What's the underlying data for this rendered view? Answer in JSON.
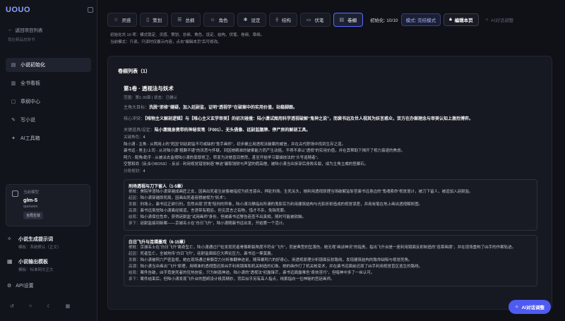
{
  "app": {
    "logo_main": "UOUO",
    "logo_accent": ""
  },
  "sidebar": {
    "back_label": "返回项目列表",
    "back_sub": "我在精品皮肤书",
    "nav": [
      {
        "label": "小说初始化",
        "icon": "book-icon",
        "active": true
      },
      {
        "label": "全书看板",
        "icon": "chart-icon",
        "active": false
      },
      {
        "label": "章纲中心",
        "icon": "file-icon",
        "active": false
      },
      {
        "label": "写小说",
        "icon": "pen-icon",
        "active": false
      },
      {
        "label": "AI工具箱",
        "icon": "toolbox-icon",
        "active": false
      }
    ],
    "model": {
      "label": "当前模型",
      "name": "glm-5",
      "provider": "qianwen",
      "badge": "全局生效"
    },
    "tools": [
      {
        "title": "小说生成提示词",
        "sub": "模板：系统默认（正文）",
        "icon": "sparkle-icon"
      },
      {
        "title": "小说输出模板",
        "sub": "模板：标准网文正文",
        "icon": "template-icon"
      }
    ],
    "api_label": "API设置"
  },
  "toolbar": {
    "tabs": [
      {
        "label": "灵感",
        "icon": "bulb-icon",
        "active": false
      },
      {
        "label": "策划",
        "icon": "book-open-icon",
        "active": false
      },
      {
        "label": "总纲",
        "icon": "list-icon",
        "active": false
      },
      {
        "label": "角色",
        "icon": "user-icon",
        "active": false
      },
      {
        "label": "设定",
        "icon": "settings-icon",
        "active": false
      },
      {
        "label": "结构",
        "icon": "structure-icon",
        "active": false
      },
      {
        "label": "伏笔",
        "icon": "note-icon",
        "active": false
      },
      {
        "label": "卷纲",
        "icon": "doc-icon",
        "active": true
      }
    ],
    "progress": "初始化: 10/10",
    "mode": "模式: 完结模式",
    "edit_label": "编辑本页",
    "ai_label": "AI对话调整"
  },
  "info": {
    "line1": "初始化共 10 项：模式锁定、灵感、策划、总纲、角色、设定、结构、伏笔、卷纲、章纲。",
    "line2": "当前模式：只读。只读时仅展示内容，点击“编辑本页”后可修改。"
  },
  "panel": {
    "title": "卷纲列表（1）",
    "volume": {
      "title": "第1卷 · 透视法与妖术",
      "meta": "范围：第1-30章 | 状态：已确认",
      "goal_k": "主角大目标：",
      "goal_v": "洗脱“邪修”嫌疑，加入廷尉监，证明“透视学”在破案中的实用价值，站稳脚跟。",
      "conflict_k": "核心冲突：",
      "conflict_v": "【唯物主义解剖逻辑】与【唯心主义玄学审美】的初次碰撞：陆小潇试图用科学透视破解“鬼神之说”，而裴书远及世人视其为妖言惑众，双方在办案理念与审美认知上激烈博弈。",
      "items_k": "关键道具/设定：",
      "items_v": "陆小潇随身携带的神秘炭笔（F001）、无头俑像、廷尉监腰牌、停尸房的解剖工具。",
      "roles_k": "关键角色：",
      "roles_count": "4",
      "roles": [
        "陆小潇 - 主角 - 从照用上的“死因”到廷尉监不可或缺的“鬼手画师”，初步确立用透视法破案的威信，并在古代职场中找到生存之道。",
        "裴书远 - 男主/上司 - 从对陆小潇“粗蹶不堪”的厌恶与怀疑，到因她精准的破案能力而产生动摇，不得不承认“透视”的实用价值，并在其帮助下揭开了视力衰退的焦虑。",
        "阿六 - 配角/助手 - 从被派去监视陆小潇的靠厚修卫，转变为对她盲目崇拜，甚至开始学习幕描技法的“头号追随者”。",
        "空慧和尚（反派小BOSS）- 反派 - 利用视觉错觉制造“神迹”骗取钱财与声望的假高僧，被陆小潇当众拆穿后身败名裂，成为主角立威的垫脚石。"
      ],
      "episodes_k": "分段规划：",
      "episodes_count": "4",
      "episodes": [
        {
          "title": "刑场透视与刀下留人（1-5章）",
          "lines": [
            {
              "k": "梗概：",
              "v": "美院学渣陆小潇穿越成画匠之女，因画出死者生前像被指控为妖言惑众，押赴刑场。生死关头，她利用透视原理当场破解监斩官裴书远身边的“鬼魂索命”视觉诡计，被刀下留人，被迫加入廷尉监。"
            },
            {
              "k": "起因：",
              "v": "陆小潇穿越即死局，因画出死者容貌被视为“妖术”。"
            },
            {
              "k": "发展：",
              "v": "刑场上，裴书远正欲行刑，忽然出现“厉鬼”阻刑的异象，陆小潇冷静指出所谓的鬼影实为利用建筑结构与光影折射造成的视觉误差，并用炭笔在地上画出透视解析图。"
            },
            {
              "k": "高潮：",
              "v": "裴书远虽觉陆小潇离经叛道，言语带有粗俗，但见其言之有物，惜才不杀，免除死罪。"
            },
            {
              "k": "结局：",
              "v": "陆小潇保住性命，获得廷尉监“试用画师”身份，但被裴书远警告若查不出真相，随时可能被砍脑。"
            },
            {
              "k": "承下：",
              "v": "廷尉监接到新案——京城名士在“白日飞升”，陆小潇随裴书远出发，开始第一个活计。"
            }
          ]
        },
        {
          "title": "白日飞升与连環墨戏（6-15章）",
          "lines": [
            {
              "k": "梗概：",
              "v": "京城名士在“白日飞升”离奇坠亡，陆小潇通过尸检发现死者骨骼断裂角度不符合“飞升”，而是典型的坠落伤。她无视“画谈神灵”的指责，指出飞升台是一座利用镜面反射制造的“连章画境”，并在现场重构了凶手的作案轨迹。"
            },
            {
              "k": "起因：",
              "v": "死者坠亡，全城热传“白日飞升”，廷尉监面临巨大舆论压力，裴书远一筹莫展。"
            },
            {
              "k": "发展：",
              "v": "陆小潇被阿六严密监视，她在现场通过骨骼受力分析推翻神迹说，随带暴阿六的好奇心，用透视原理分析镜面反射路线，发现建筑结构的致命缺陷与视觉死角。"
            },
            {
              "k": "高潮：",
              "v": "陆小潇当众画出“飞升”原理，用精准的透视图还原凶手利用镜面和机关制造的幻象。她的画作打了机关帐变术，并在裴书远面前还原了凶手利用视觉盲区逃生的路线。"
            },
            {
              "k": "结局：",
              "v": "案件告破，凶手竟是死者的狂热信徒，只为制造神迹。陆小潇的“透视法”初露锋芒，裴书远面露难色“奇技淫巧”，但暗神中多了一丝认可。"
            },
            {
              "k": "承下：",
              "v": "案件结束后，但陆小潇发现飞升台的图纸设计极其精妙，背后似乎另有高人指点，线索指向一位神秘的宫廷画师。"
            }
          ]
        }
      ]
    }
  },
  "fab": {
    "label": "AI对话调整"
  }
}
